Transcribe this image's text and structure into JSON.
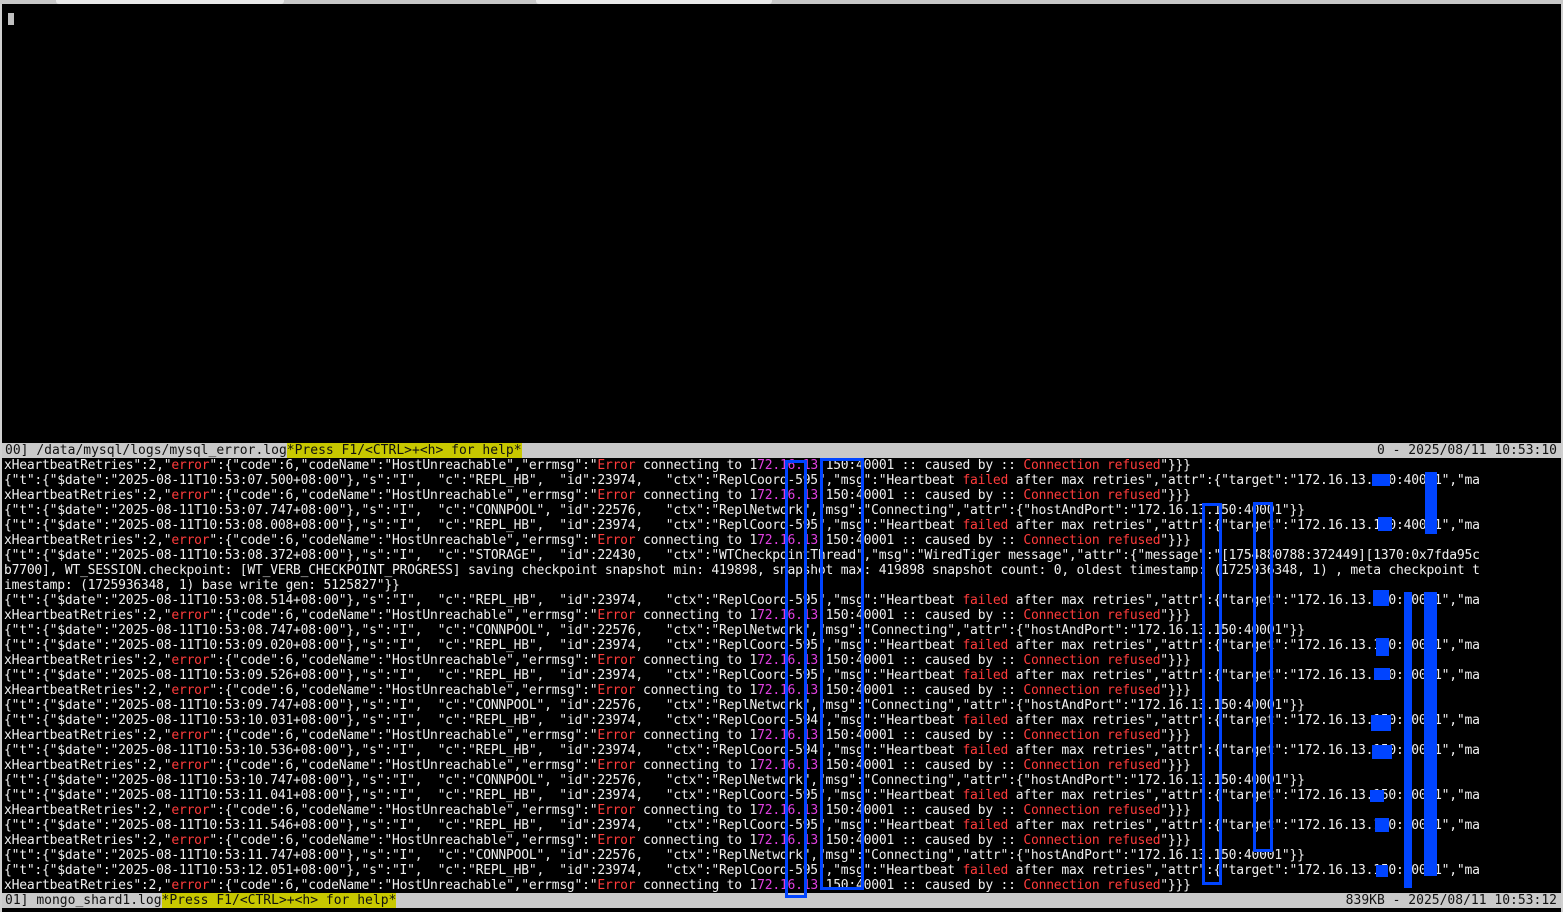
{
  "top_pane": {
    "pane_label": "00]",
    "file_path": "/data/mysql/logs/mysql_error.log",
    "help_text": "*Press F1/<CTRL>+<h> for help*",
    "position_info": "0 - 2025/08/11 10:53:10"
  },
  "bottom_pane": {
    "pane_label": "01]",
    "file_path": "mongo_shard1.log",
    "help_text": "*Press F1/<CTRL>+<h> for help*",
    "position_info": "839KB - 2025/08/11 10:53:12"
  },
  "colors": {
    "error": "#ff3b3b",
    "magenta": "#e040e0",
    "redaction": "#0044ff",
    "status_bg": "#c9c9c9",
    "help_bg": "#c8c800"
  },
  "log_lines": [
    [
      "xHeartbeatRetries\":2,\"",
      {
        "e": "error"
      },
      "\":{\"code\":6,\"codeName\":\"HostUnreachable\",\"errmsg\":\"",
      {
        "e": "Error"
      },
      " connecting to 1",
      {
        "m": "72.16.13"
      },
      ".150:40001 :: caused by :: ",
      {
        "e": "Connection refused"
      },
      "\"}}}"
    ],
    [
      "{\"t\":{\"$date\":\"2025-08-11T10:53:07.500+08:00\"},\"s\":\"I\",  \"c\":\"REPL_HB\",  \"id\":23974,   \"ctx\":\"ReplCoord-595\",\"msg\":\"Heartbeat ",
      {
        "e": "failed"
      },
      " after max retries\",\"attr\":{\"target\":\"172.16.13.150:40001\",\"ma"
    ],
    [
      "xHeartbeatRetries\":2,\"",
      {
        "e": "error"
      },
      "\":{\"code\":6,\"codeName\":\"HostUnreachable\",\"errmsg\":\"",
      {
        "e": "Error"
      },
      " connecting to 1",
      {
        "m": "72.16.13"
      },
      ".150:40001 :: caused by :: ",
      {
        "e": "Connection refused"
      },
      "\"}}}"
    ],
    [
      "{\"t\":{\"$date\":\"2025-08-11T10:53:07.747+08:00\"},\"s\":\"I\",  \"c\":\"CONNPOOL\", \"id\":22576,   \"ctx\":\"ReplNetwork\",\"msg\":\"Connecting\",\"attr\":{\"hostAndPort\":\"172.16.13.150:40001\"}}"
    ],
    [
      "{\"t\":{\"$date\":\"2025-08-11T10:53:08.008+08:00\"},\"s\":\"I\",  \"c\":\"REPL_HB\",  \"id\":23974,   \"ctx\":\"ReplCoord-595\",\"msg\":\"Heartbeat ",
      {
        "e": "failed"
      },
      " after max retries\",\"attr\":{\"target\":\"172.16.13.150:40001\",\"ma"
    ],
    [
      "xHeartbeatRetries\":2,\"",
      {
        "e": "error"
      },
      "\":{\"code\":6,\"codeName\":\"HostUnreachable\",\"errmsg\":\"",
      {
        "e": "Error"
      },
      " connecting to 1",
      {
        "m": "72.16.13"
      },
      ".150:40001 :: caused by :: ",
      {
        "e": "Connection refused"
      },
      "\"}}}"
    ],
    [
      "{\"t\":{\"$date\":\"2025-08-11T10:53:08.372+08:00\"},\"s\":\"I\",  \"c\":\"STORAGE\",  \"id\":22430,   \"ctx\":\"WTCheckpointThread\",\"msg\":\"WiredTiger message\",\"attr\":{\"message\":\"[1754880788:372449][1370:0x7fda95c"
    ],
    [
      "b7700], WT_SESSION.checkpoint: [WT_VERB_CHECKPOINT_PROGRESS] saving checkpoint snapshot min: 419898, snapshot max: 419898 snapshot count: 0, oldest timestamp: (1725936348, 1) , meta checkpoint t"
    ],
    [
      "imestamp: (1725936348, 1) base write gen: 5125827\"}}"
    ],
    [
      "{\"t\":{\"$date\":\"2025-08-11T10:53:08.514+08:00\"},\"s\":\"I\",  \"c\":\"REPL_HB\",  \"id\":23974,   \"ctx\":\"ReplCoord-595\",\"msg\":\"Heartbeat ",
      {
        "e": "failed"
      },
      " after max retries\",\"attr\":{\"target\":\"172.16.13.150:40001\",\"ma"
    ],
    [
      "xHeartbeatRetries\":2,\"",
      {
        "e": "error"
      },
      "\":{\"code\":6,\"codeName\":\"HostUnreachable\",\"errmsg\":\"",
      {
        "e": "Error"
      },
      " connecting to 1",
      {
        "m": "72.16.13"
      },
      ".150:40001 :: caused by :: ",
      {
        "e": "Connection refused"
      },
      "\"}}}"
    ],
    [
      "{\"t\":{\"$date\":\"2025-08-11T10:53:08.747+08:00\"},\"s\":\"I\",  \"c\":\"CONNPOOL\", \"id\":22576,   \"ctx\":\"ReplNetwork\",\"msg\":\"Connecting\",\"attr\":{\"hostAndPort\":\"172.16.13.150:40001\"}}"
    ],
    [
      "{\"t\":{\"$date\":\"2025-08-11T10:53:09.020+08:00\"},\"s\":\"I\",  \"c\":\"REPL_HB\",  \"id\":23974,   \"ctx\":\"ReplCoord-595\",\"msg\":\"Heartbeat ",
      {
        "e": "failed"
      },
      " after max retries\",\"attr\":{\"target\":\"172.16.13.150:40001\",\"ma"
    ],
    [
      "xHeartbeatRetries\":2,\"",
      {
        "e": "error"
      },
      "\":{\"code\":6,\"codeName\":\"HostUnreachable\",\"errmsg\":\"",
      {
        "e": "Error"
      },
      " connecting to 1",
      {
        "m": "72.16.13"
      },
      ".150:40001 :: caused by :: ",
      {
        "e": "Connection refused"
      },
      "\"}}}"
    ],
    [
      "{\"t\":{\"$date\":\"2025-08-11T10:53:09.526+08:00\"},\"s\":\"I\",  \"c\":\"REPL_HB\",  \"id\":23974,   \"ctx\":\"ReplCoord-595\",\"msg\":\"Heartbeat ",
      {
        "e": "failed"
      },
      " after max retries\",\"attr\":{\"target\":\"172.16.13.150:40001\",\"ma"
    ],
    [
      "xHeartbeatRetries\":2,\"",
      {
        "e": "error"
      },
      "\":{\"code\":6,\"codeName\":\"HostUnreachable\",\"errmsg\":\"",
      {
        "e": "Error"
      },
      " connecting to 1",
      {
        "m": "72.16.13"
      },
      ".150:40001 :: caused by :: ",
      {
        "e": "Connection refused"
      },
      "\"}}}"
    ],
    [
      "{\"t\":{\"$date\":\"2025-08-11T10:53:09.747+08:00\"},\"s\":\"I\",  \"c\":\"CONNPOOL\", \"id\":22576,   \"ctx\":\"ReplNetwork\",\"msg\":\"Connecting\",\"attr\":{\"hostAndPort\":\"172.16.13.150:40001\"}}"
    ],
    [
      "{\"t\":{\"$date\":\"2025-08-11T10:53:10.031+08:00\"},\"s\":\"I\",  \"c\":\"REPL_HB\",  \"id\":23974,   \"ctx\":\"ReplCoord-594\",\"msg\":\"Heartbeat ",
      {
        "e": "failed"
      },
      " after max retries\",\"attr\":{\"target\":\"172.16.13.150:40001\",\"ma"
    ],
    [
      "xHeartbeatRetries\":2,\"",
      {
        "e": "error"
      },
      "\":{\"code\":6,\"codeName\":\"HostUnreachable\",\"errmsg\":\"",
      {
        "e": "Error"
      },
      " connecting to 1",
      {
        "m": "72.16.13"
      },
      ".150:40001 :: caused by :: ",
      {
        "e": "Connection refused"
      },
      "\"}}}"
    ],
    [
      "{\"t\":{\"$date\":\"2025-08-11T10:53:10.536+08:00\"},\"s\":\"I\",  \"c\":\"REPL_HB\",  \"id\":23974,   \"ctx\":\"ReplCoord-594\",\"msg\":\"Heartbeat ",
      {
        "e": "failed"
      },
      " after max retries\",\"attr\":{\"target\":\"172.16.13.150:40001\",\"ma"
    ],
    [
      "xHeartbeatRetries\":2,\"",
      {
        "e": "error"
      },
      "\":{\"code\":6,\"codeName\":\"HostUnreachable\",\"errmsg\":\"",
      {
        "e": "Error"
      },
      " connecting to 1",
      {
        "m": "72.16.13"
      },
      ".150:40001 :: caused by :: ",
      {
        "e": "Connection refused"
      },
      "\"}}}"
    ],
    [
      "{\"t\":{\"$date\":\"2025-08-11T10:53:10.747+08:00\"},\"s\":\"I\",  \"c\":\"CONNPOOL\", \"id\":22576,   \"ctx\":\"ReplNetwork\",\"msg\":\"Connecting\",\"attr\":{\"hostAndPort\":\"172.16.13.150:40001\"}}"
    ],
    [
      "{\"t\":{\"$date\":\"2025-08-11T10:53:11.041+08:00\"},\"s\":\"I\",  \"c\":\"REPL_HB\",  \"id\":23974,   \"ctx\":\"ReplCoord-595\",\"msg\":\"Heartbeat ",
      {
        "e": "failed"
      },
      " after max retries\",\"attr\":{\"target\":\"172.16.13.150:40001\",\"ma"
    ],
    [
      "xHeartbeatRetries\":2,\"",
      {
        "e": "error"
      },
      "\":{\"code\":6,\"codeName\":\"HostUnreachable\",\"errmsg\":\"",
      {
        "e": "Error"
      },
      " connecting to 1",
      {
        "m": "72.16.13"
      },
      ".150:40001 :: caused by :: ",
      {
        "e": "Connection refused"
      },
      "\"}}}"
    ],
    [
      "{\"t\":{\"$date\":\"2025-08-11T10:53:11.546+08:00\"},\"s\":\"I\",  \"c\":\"REPL_HB\",  \"id\":23974,   \"ctx\":\"ReplCoord-595\",\"msg\":\"Heartbeat ",
      {
        "e": "failed"
      },
      " after max retries\",\"attr\":{\"target\":\"172.16.13.150:40001\",\"ma"
    ],
    [
      "xHeartbeatRetries\":2,\"",
      {
        "e": "error"
      },
      "\":{\"code\":6,\"codeName\":\"HostUnreachable\",\"errmsg\":\"",
      {
        "e": "Error"
      },
      " connecting to 1",
      {
        "m": "72.16.13"
      },
      ".150:40001 :: caused by :: ",
      {
        "e": "Connection refused"
      },
      "\"}}}"
    ],
    [
      "{\"t\":{\"$date\":\"2025-08-11T10:53:11.747+08:00\"},\"s\":\"I\",  \"c\":\"CONNPOOL\", \"id\":22576,   \"ctx\":\"ReplNetwork\",\"msg\":\"Connecting\",\"attr\":{\"hostAndPort\":\"172.16.13.150:40001\"}}"
    ],
    [
      "{\"t\":{\"$date\":\"2025-08-11T10:53:12.051+08:00\"},\"s\":\"I\",  \"c\":\"REPL_HB\",  \"id\":23974,   \"ctx\":\"ReplCoord-595\",\"msg\":\"Heartbeat ",
      {
        "e": "failed"
      },
      " after max retries\",\"attr\":{\"target\":\"172.16.13.150:40001\",\"ma"
    ],
    [
      "xHeartbeatRetries\":2,\"",
      {
        "e": "error"
      },
      "\":{\"code\":6,\"codeName\":\"HostUnreachable\",\"errmsg\":\"",
      {
        "e": "Error"
      },
      " connecting to 1",
      {
        "m": "72.16.13"
      },
      ".150:40001 :: caused by :: ",
      {
        "e": "Connection refused"
      },
      "\"}}}"
    ]
  ]
}
